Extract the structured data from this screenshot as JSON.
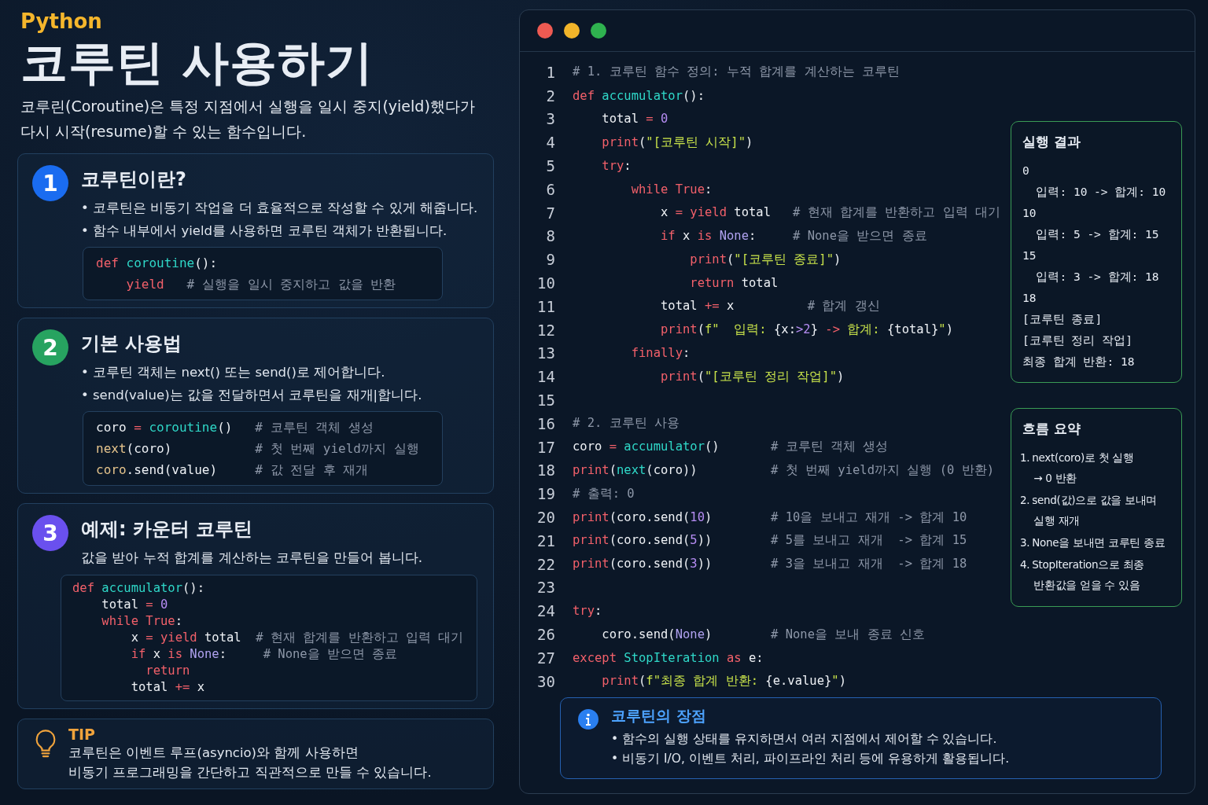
{
  "language": "Python",
  "title": "코루틴 사용하기",
  "intro": "코루린(Coroutine)은 특정 지점에서 실행을 일시 중지(yield)했다가 다시 시작(resume)할 수 있는 함수입니다.",
  "sections": [
    {
      "number": "1",
      "color": "#1a6cf0",
      "heading": "코루틴이란?",
      "bullets": [
        "• 코루틴은 비동기 작업을 더 효율적으로 작성할 수 있게 해줍니다.",
        "• 함수 내부에서 yield를 사용하면 코루틴 객체가 반환됩니다."
      ],
      "code": [
        [
          {
            "text": "def ",
            "kind": "kw"
          },
          {
            "text": "coroutine",
            "kind": "fn"
          },
          {
            "text": "():",
            "kind": "p"
          }
        ],
        [
          {
            "text": "    yield",
            "kind": "kw"
          },
          {
            "text": "   # 실행을 일시 중지하고 값을 반환",
            "kind": "cm"
          }
        ]
      ]
    },
    {
      "number": "2",
      "color": "#27a360",
      "heading": "기본 사용법",
      "bullets": [
        "• 코루틴 객체는 next() 또는 send()로 제어합니다.",
        "• send(value)는 값을 전달하면서 코루틴을 재개|합니다."
      ],
      "code": [
        [
          {
            "text": "coro ",
            "kind": "p"
          },
          {
            "text": "= ",
            "kind": "op"
          },
          {
            "text": "coroutine",
            "kind": "fn"
          },
          {
            "text": "()   ",
            "kind": "p"
          },
          {
            "text": "# 코루틴 객체 생성",
            "kind": "cm"
          }
        ],
        [
          {
            "text": "next",
            "kind": "attr"
          },
          {
            "text": "(coro)           ",
            "kind": "p"
          },
          {
            "text": "# 첫 번째 yield까지 실행",
            "kind": "cm"
          }
        ],
        [
          {
            "text": "coro",
            "kind": "attr"
          },
          {
            "text": ".send(value)     ",
            "kind": "p"
          },
          {
            "text": "# 값 전달 후 재개",
            "kind": "cm"
          }
        ]
      ]
    },
    {
      "number": "3",
      "color": "#6a50ee",
      "heading": "예제: 카운터 코루틴",
      "description": "값을 받아 누적 합계를 계산하는 코루틴을 만들어 봅니다.",
      "code": [
        [
          {
            "text": "def ",
            "kind": "kw"
          },
          {
            "text": "accumulator",
            "kind": "fn"
          },
          {
            "text": "():",
            "kind": "p"
          }
        ],
        [
          {
            "text": "    total ",
            "kind": "p"
          },
          {
            "text": "= ",
            "kind": "op"
          },
          {
            "text": "0",
            "kind": "num"
          }
        ],
        [
          {
            "text": "    while True",
            "kind": "kw"
          },
          {
            "text": ":",
            "kind": "p"
          }
        ],
        [
          {
            "text": "        x ",
            "kind": "p"
          },
          {
            "text": "= yield",
            "kind": "kw"
          },
          {
            "text": " total  ",
            "kind": "p"
          },
          {
            "text": "# 현재 합계를 반환하고 입력 대기",
            "kind": "cm"
          }
        ],
        [
          {
            "text": "        if",
            "kind": "kw"
          },
          {
            "text": " x ",
            "kind": "p"
          },
          {
            "text": "is ",
            "kind": "kw"
          },
          {
            "text": "None",
            "kind": "const"
          },
          {
            "text": ":     ",
            "kind": "p"
          },
          {
            "text": "# None을 받으면 종료",
            "kind": "cm"
          }
        ],
        [
          {
            "text": "          return",
            "kind": "kw"
          }
        ],
        [
          {
            "text": "        total ",
            "kind": "p"
          },
          {
            "text": "+=",
            "kind": "op"
          },
          {
            "text": " x",
            "kind": "p"
          }
        ]
      ]
    }
  ],
  "tip": {
    "label": "TIP",
    "lines": [
      "코루틴은 이벤트 루프(asyncio)와 함께 사용하면",
      "비동기 프로그래밍을 간단하고 직관적으로 만들 수 있습니다."
    ]
  },
  "editor": {
    "lines": [
      {
        "number": "1",
        "tokens": [
          {
            "text": "# 1. 코루틴 함수 정의: 누적 합계를 계산하는 코루틴",
            "kind": "cm"
          }
        ]
      },
      {
        "number": "2",
        "tokens": [
          {
            "text": "def ",
            "kind": "kw"
          },
          {
            "text": "accumulator",
            "kind": "fn"
          },
          {
            "text": "():",
            "kind": "p"
          }
        ]
      },
      {
        "number": "3",
        "tokens": [
          {
            "text": "    total ",
            "kind": "p"
          },
          {
            "text": "= ",
            "kind": "op"
          },
          {
            "text": "0",
            "kind": "num"
          }
        ]
      },
      {
        "number": "4",
        "tokens": [
          {
            "text": "    print",
            "kind": "kw"
          },
          {
            "text": "(",
            "kind": "p"
          },
          {
            "text": "\"[코루틴 시작]\"",
            "kind": "str"
          },
          {
            "text": ")",
            "kind": "p"
          }
        ]
      },
      {
        "number": "5",
        "tokens": [
          {
            "text": "    try",
            "kind": "kw"
          },
          {
            "text": ":",
            "kind": "p"
          }
        ]
      },
      {
        "number": "6",
        "tokens": [
          {
            "text": "        while True",
            "kind": "kw"
          },
          {
            "text": ":",
            "kind": "p"
          }
        ]
      },
      {
        "number": "7",
        "tokens": [
          {
            "text": "            x ",
            "kind": "p"
          },
          {
            "text": "= yield",
            "kind": "kw"
          },
          {
            "text": " total   ",
            "kind": "p"
          },
          {
            "text": "# 현재 합계를 반환하고 입력 대기",
            "kind": "cm"
          }
        ]
      },
      {
        "number": "8",
        "tokens": [
          {
            "text": "            if",
            "kind": "kw"
          },
          {
            "text": " x ",
            "kind": "p"
          },
          {
            "text": "is ",
            "kind": "kw"
          },
          {
            "text": "None",
            "kind": "const"
          },
          {
            "text": ":     ",
            "kind": "p"
          },
          {
            "text": "# None을 받으면 종료",
            "kind": "cm"
          }
        ]
      },
      {
        "number": "9",
        "tokens": [
          {
            "text": "                print",
            "kind": "kw"
          },
          {
            "text": "(",
            "kind": "p"
          },
          {
            "text": "\"[코루틴 종료]\"",
            "kind": "str"
          },
          {
            "text": ")",
            "kind": "p"
          }
        ]
      },
      {
        "number": "10",
        "tokens": [
          {
            "text": "                return",
            "kind": "kw"
          },
          {
            "text": " total",
            "kind": "p"
          }
        ]
      },
      {
        "number": "11",
        "tokens": [
          {
            "text": "            total ",
            "kind": "p"
          },
          {
            "text": "+=",
            "kind": "op"
          },
          {
            "text": " x          ",
            "kind": "p"
          },
          {
            "text": "# 합계 갱신",
            "kind": "cm"
          }
        ]
      },
      {
        "number": "12",
        "tokens": [
          {
            "text": "            print",
            "kind": "kw"
          },
          {
            "text": "(",
            "kind": "p"
          },
          {
            "text": "f\"  입력: ",
            "kind": "str"
          },
          {
            "text": "{x:",
            "kind": "p"
          },
          {
            "text": ">2",
            "kind": "num"
          },
          {
            "text": "} ",
            "kind": "p"
          },
          {
            "text": "->",
            "kind": "op"
          },
          {
            "text": " 합계: ",
            "kind": "str"
          },
          {
            "text": "{total}",
            "kind": "p"
          },
          {
            "text": "\"",
            "kind": "str"
          },
          {
            "text": ")",
            "kind": "p"
          }
        ]
      },
      {
        "number": "13",
        "tokens": [
          {
            "text": "        finally",
            "kind": "kw"
          },
          {
            "text": ":",
            "kind": "p"
          }
        ]
      },
      {
        "number": "14",
        "tokens": [
          {
            "text": "            print",
            "kind": "kw"
          },
          {
            "text": "(",
            "kind": "p"
          },
          {
            "text": "\"[코루틴 정리 작업]\"",
            "kind": "str"
          },
          {
            "text": ")",
            "kind": "p"
          }
        ]
      },
      {
        "number": "15"
      },
      {
        "number": "16",
        "tokens": [
          {
            "text": "# 2. 코루틴 사용",
            "kind": "cm"
          }
        ]
      },
      {
        "number": "17",
        "tokens": [
          {
            "text": "coro ",
            "kind": "p"
          },
          {
            "text": "= ",
            "kind": "op"
          },
          {
            "text": "accumulator",
            "kind": "fn"
          },
          {
            "text": "()       ",
            "kind": "p"
          },
          {
            "text": "# 코루틴 객체 생성",
            "kind": "cm"
          }
        ]
      },
      {
        "number": "18",
        "tokens": [
          {
            "text": "print",
            "kind": "kw"
          },
          {
            "text": "(",
            "kind": "p"
          },
          {
            "text": "next",
            "kind": "fn"
          },
          {
            "text": "(coro))          ",
            "kind": "p"
          },
          {
            "text": "# 첫 번째 yield까지 실행 (0 반환)",
            "kind": "cm"
          }
        ]
      },
      {
        "number": "19",
        "tokens": [
          {
            "text": "# 출력: 0",
            "kind": "cm"
          }
        ]
      },
      {
        "number": "20",
        "tokens": [
          {
            "text": "print",
            "kind": "kw"
          },
          {
            "text": "(coro.send(",
            "kind": "p"
          },
          {
            "text": "10",
            "kind": "num"
          },
          {
            "text": ")        ",
            "kind": "p"
          },
          {
            "text": "# 10을 보내고 재개 -> 합계 10",
            "kind": "cm"
          }
        ]
      },
      {
        "number": "21",
        "tokens": [
          {
            "text": "print",
            "kind": "kw"
          },
          {
            "text": "(coro.send(",
            "kind": "p"
          },
          {
            "text": "5",
            "kind": "num"
          },
          {
            "text": "))        ",
            "kind": "p"
          },
          {
            "text": "# 5를 보내고 재개  -> 합계 15",
            "kind": "cm"
          }
        ]
      },
      {
        "number": "22",
        "tokens": [
          {
            "text": "print",
            "kind": "kw"
          },
          {
            "text": "(coro.send(",
            "kind": "p"
          },
          {
            "text": "3",
            "kind": "num"
          },
          {
            "text": "))        ",
            "kind": "p"
          },
          {
            "text": "# 3을 보내고 재개  -> 합계 18",
            "kind": "cm"
          }
        ]
      },
      {
        "number": "23"
      },
      {
        "number": "24",
        "tokens": [
          {
            "text": "try",
            "kind": "kw"
          },
          {
            "text": ":",
            "kind": "p"
          }
        ]
      },
      {
        "number": "26",
        "tokens": [
          {
            "text": "    coro.send(",
            "kind": "p"
          },
          {
            "text": "None",
            "kind": "const"
          },
          {
            "text": ")        ",
            "kind": "p"
          },
          {
            "text": "# None을 보내 종료 신호",
            "kind": "cm"
          }
        ]
      },
      {
        "number": "27",
        "tokens": [
          {
            "text": "except ",
            "kind": "kw"
          },
          {
            "text": "StopIteration ",
            "kind": "fn"
          },
          {
            "text": "as",
            "kind": "kw"
          },
          {
            "text": " e:",
            "kind": "p"
          }
        ]
      },
      {
        "number": "30",
        "tokens": [
          {
            "text": "    print",
            "kind": "kw"
          },
          {
            "text": "(",
            "kind": "p"
          },
          {
            "text": "f\"최종 합계 반환: ",
            "kind": "str"
          },
          {
            "text": "{e.value}",
            "kind": "p"
          },
          {
            "text": "\"",
            "kind": "str"
          },
          {
            "text": ")",
            "kind": "p"
          }
        ]
      }
    ],
    "output": {
      "title": "실행 결과",
      "lines": [
        "0",
        "  입력: 10 -> 합계: 10",
        "10",
        "  입력: 5 -> 합계: 15",
        "15",
        "  입력: 3 -> 합계: 18",
        "18",
        "[코루틴 종료]",
        "[코루틴 정리 작업]",
        "최종 합계 반환: 18"
      ]
    },
    "summary": {
      "title": "흐름 요약",
      "items": [
        {
          "number": "1.",
          "text": "next(coro)로 첫 실행",
          "detail": "→ 0 반환"
        },
        {
          "number": "2.",
          "text": "send(값)으로 값을 보내며",
          "detail": "실행 재개"
        },
        {
          "number": "3.",
          "text": "None을 보내면 코루틴 종료"
        },
        {
          "number": "4.",
          "text": "StopIteration으로 최종",
          "detail": "반환값을 얻을 수 있음"
        }
      ]
    },
    "note": {
      "title": "코루틴의 장점",
      "bullets": [
        "• 함수의 실행 상태를 유지하면서 여러 지점에서 제어할 수 있습니다.",
        "• 비동기 I/O, 이벤트 처리, 파이프라인 처리 등에 유용하게 활용됩니다."
      ]
    }
  }
}
